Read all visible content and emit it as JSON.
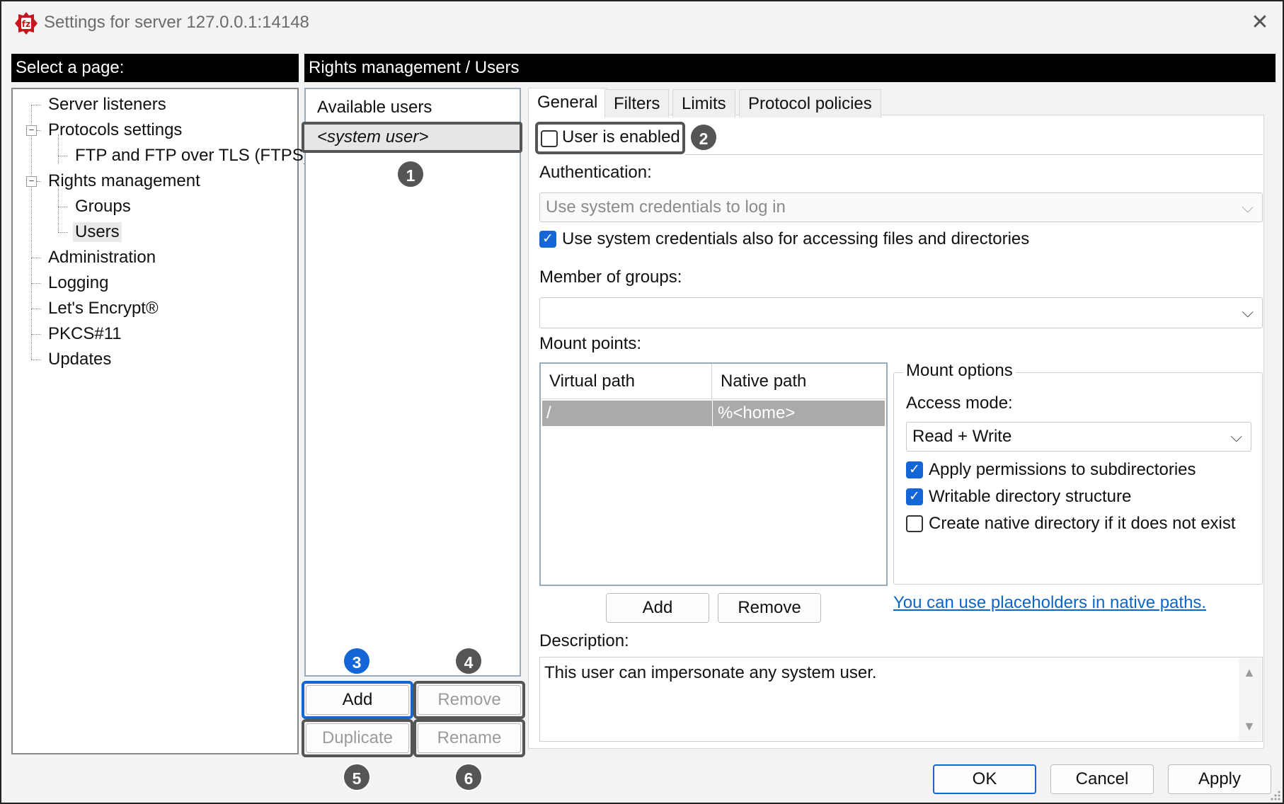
{
  "window": {
    "title": "Settings for server 127.0.0.1:14148",
    "close_glyph": "✕"
  },
  "left_header": "Select a page:",
  "right_header": "Rights management / Users",
  "tree": {
    "items": [
      {
        "label": "Server listeners"
      },
      {
        "label": "Protocols settings"
      },
      {
        "label": "FTP and FTP over TLS (FTPS)"
      },
      {
        "label": "Rights management"
      },
      {
        "label": "Groups"
      },
      {
        "label": "Users"
      },
      {
        "label": "Administration"
      },
      {
        "label": "Logging"
      },
      {
        "label": "Let's Encrypt®"
      },
      {
        "label": "PKCS#11"
      },
      {
        "label": "Updates"
      }
    ],
    "expander_glyph": "−"
  },
  "users": {
    "header": "Available users",
    "selected_user": "<system user>",
    "buttons": {
      "add": "Add",
      "remove": "Remove",
      "duplicate": "Duplicate",
      "rename": "Rename"
    }
  },
  "badges": [
    "1",
    "2",
    "3",
    "4",
    "5",
    "6"
  ],
  "tabs": [
    "General",
    "Filters",
    "Limits",
    "Protocol policies"
  ],
  "general": {
    "user_enabled_label": "User is enabled",
    "authentication_label": "Authentication:",
    "authentication_value": "Use system credentials to log in",
    "use_system_credentials_label": "Use system credentials also for accessing files and directories",
    "member_of_groups_label": "Member of groups:",
    "member_of_groups_value": "",
    "mount_points_label": "Mount points:",
    "mount_table": {
      "columns": [
        "Virtual path",
        "Native path"
      ],
      "rows": [
        [
          "/",
          "%<home>"
        ]
      ]
    },
    "mount_add": "Add",
    "mount_remove": "Remove",
    "mount_options": {
      "title": "Mount options",
      "access_mode_label": "Access mode:",
      "access_mode_value": "Read + Write",
      "apply_permissions_label": "Apply permissions to subdirectories",
      "writable_structure_label": "Writable directory structure",
      "create_native_dir_label": "Create native directory if it does not exist"
    },
    "placeholders_link": "You can use placeholders in native paths.",
    "description_label": "Description:",
    "description_value": "This user can impersonate any system user."
  },
  "checkbox_states": {
    "user_enabled": false,
    "use_system_credentials": true,
    "apply_permissions": true,
    "writable_structure": true,
    "create_native_dir": false
  },
  "check_glyph": "✓",
  "chevron_glyph": "⌵",
  "dialog_buttons": {
    "ok": "OK",
    "cancel": "Cancel",
    "apply": "Apply"
  },
  "colors": {
    "accent": "#1466d6",
    "highlight_border": "#555555",
    "link": "#0a66c9"
  },
  "icons": {
    "app": "filezilla-server-icon",
    "close": "close-icon",
    "dropdown": "chevron-down-icon"
  }
}
